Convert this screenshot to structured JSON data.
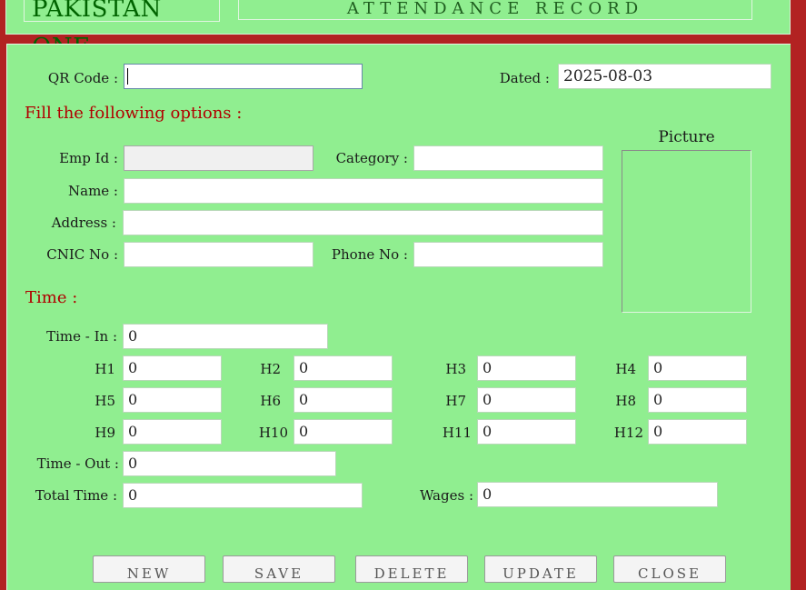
{
  "header": {
    "company": "PAKISTAN ONE",
    "title": "ATTENDANCE RECORD"
  },
  "form": {
    "qr_code_label": "QR Code :",
    "qr_code_value": "",
    "dated_label": "Dated :",
    "dated_value": "2025-08-03",
    "options_heading": "Fill the following options :",
    "emp_id_label": "Emp Id :",
    "emp_id_value": "",
    "category_label": "Category :",
    "category_value": "",
    "name_label": "Name :",
    "name_value": "",
    "address_label": "Address :",
    "address_value": "",
    "cnic_label": "CNIC No :",
    "cnic_value": "",
    "phone_label": "Phone No :",
    "phone_value": "",
    "picture_label": "Picture"
  },
  "time": {
    "heading": "Time :",
    "time_in_label": "Time - In :",
    "time_in_value": "0",
    "hours": [
      {
        "label": "H1",
        "value": "0"
      },
      {
        "label": "H2",
        "value": "0"
      },
      {
        "label": "H3",
        "value": "0"
      },
      {
        "label": "H4",
        "value": "0"
      },
      {
        "label": "H5",
        "value": "0"
      },
      {
        "label": "H6",
        "value": "0"
      },
      {
        "label": "H7",
        "value": "0"
      },
      {
        "label": "H8",
        "value": "0"
      },
      {
        "label": "H9",
        "value": "0"
      },
      {
        "label": "H10",
        "value": "0"
      },
      {
        "label": "H11",
        "value": "0"
      },
      {
        "label": "H12",
        "value": "0"
      }
    ],
    "time_out_label": "Time - Out :",
    "time_out_value": "0",
    "total_time_label": "Total Time :",
    "total_time_value": "0",
    "wages_label": "Wages :",
    "wages_value": "0"
  },
  "buttons": [
    "NEW",
    "SAVE",
    "DELETE",
    "UPDATE",
    "CLOSE"
  ],
  "colors": {
    "frame": "#b22222",
    "panel": "#90ee90",
    "heading_red": "#b00000",
    "title_green": "#006400"
  }
}
